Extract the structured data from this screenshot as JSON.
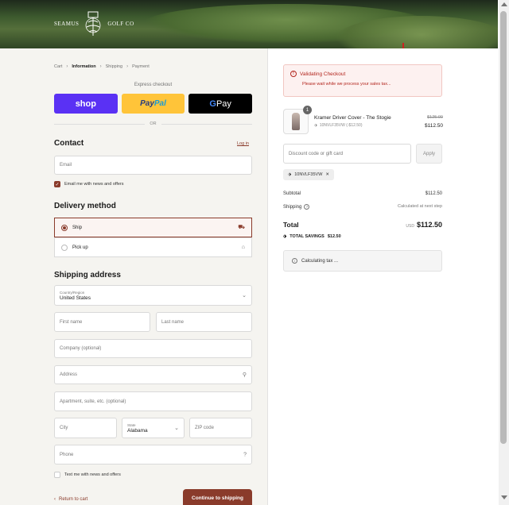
{
  "brand": {
    "left_word": "SEAMUS",
    "right_word": "GOLF CO"
  },
  "breadcrumb": {
    "items": [
      "Cart",
      "Information",
      "Shipping",
      "Payment"
    ],
    "active": "Information"
  },
  "express": {
    "label": "Express checkout",
    "shop": "shop",
    "paypal_a": "Pay",
    "paypal_b": "Pal",
    "gpay_g": "G",
    "gpay_text": " Pay",
    "or": "OR"
  },
  "contact": {
    "heading": "Contact",
    "login": "Log in",
    "email_placeholder": "Email",
    "news_label": "Email me with news and offers"
  },
  "delivery": {
    "heading": "Delivery method",
    "ship": "Ship",
    "pickup": "Pick up"
  },
  "shipping": {
    "heading": "Shipping address",
    "country_label": "Country/Region",
    "country_value": "United States",
    "first_name": "First name",
    "last_name": "Last name",
    "company": "Company (optional)",
    "address": "Address",
    "apartment": "Apartment, suite, etc. (optional)",
    "city": "City",
    "state_label": "State",
    "state_value": "Alabama",
    "zip": "ZIP code",
    "phone": "Phone",
    "sms_label": "Text me with news and offers"
  },
  "footer": {
    "return": "Return to cart",
    "continue": "Continue to shipping"
  },
  "alert": {
    "title": "Validating Checkout",
    "message": "Please wait while we process your sales tax..."
  },
  "order": {
    "item_name": "Kramer Driver Cover - The Stogie",
    "item_qty": "1",
    "item_sub": "10NVLF35VW (-$12.50)",
    "item_old_price": "$125.00",
    "item_price": "$112.50",
    "discount_placeholder": "Discount code or gift card",
    "apply": "Apply",
    "code_chip": "10NVLF35VW",
    "subtotal_label": "Subtotal",
    "subtotal_value": "$112.50",
    "shipping_label": "Shipping",
    "shipping_value": "Calculated at next step",
    "total_label": "Total",
    "currency": "USD",
    "total_value": "$112.50",
    "savings_label": "TOTAL SAVINGS",
    "savings_value": "$12.50",
    "calculating": "Calculating tax ..."
  },
  "colors": {
    "accent": "#8a3b2b",
    "shop": "#5a31f4",
    "paypal": "#ffc439",
    "alert": "#b3261e"
  }
}
